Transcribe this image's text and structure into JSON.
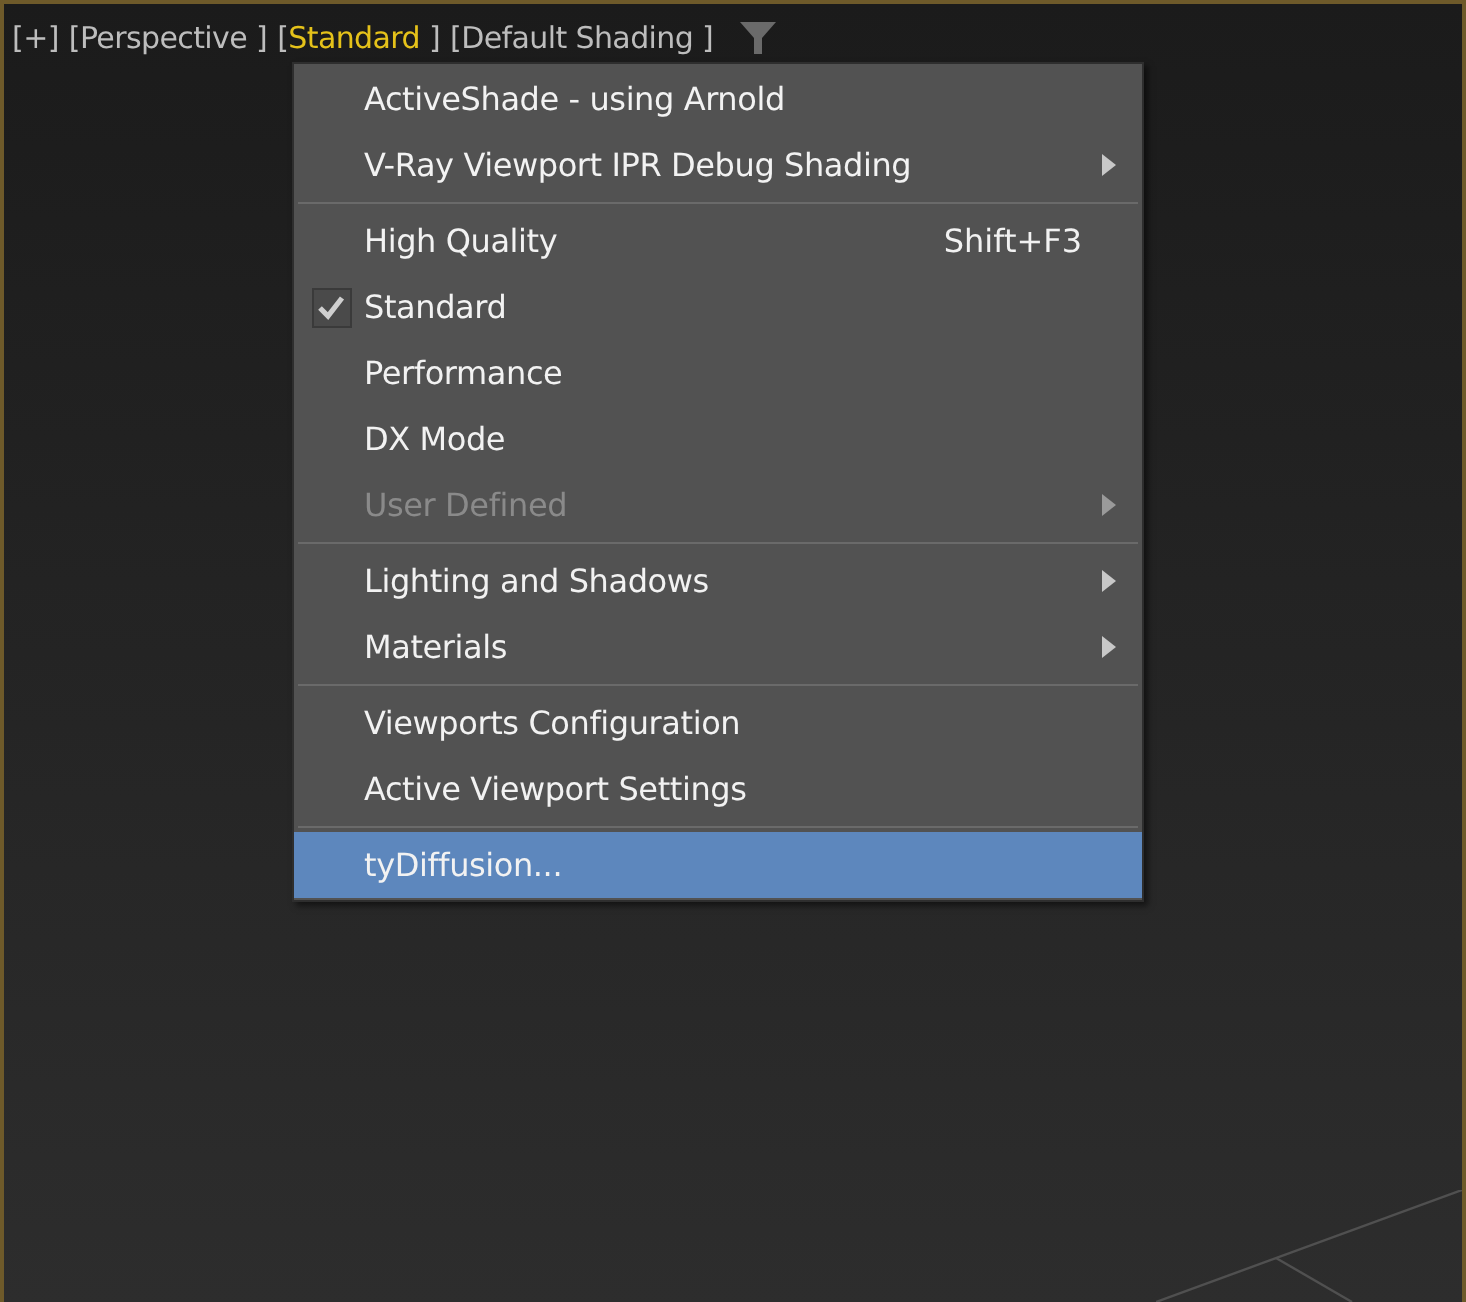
{
  "viewport": {
    "labels": [
      {
        "open": "[",
        "text": "+",
        "close": "]",
        "highlighted": false
      },
      {
        "open": "[",
        "text": "Perspective",
        "close": " ]",
        "highlighted": false
      },
      {
        "open": "[",
        "text": "Standard",
        "close": " ]",
        "highlighted": true
      },
      {
        "open": "[",
        "text": "Default Shading",
        "close": " ]",
        "highlighted": false
      }
    ],
    "menu": {
      "items": [
        {
          "kind": "item",
          "label": "ActiveShade - using Arnold",
          "checked": false,
          "disabled": false,
          "has_submenu": false,
          "selected": false
        },
        {
          "kind": "item",
          "label": "V-Ray Viewport IPR Debug Shading",
          "checked": false,
          "disabled": false,
          "has_submenu": true,
          "selected": false
        },
        {
          "kind": "separator"
        },
        {
          "kind": "item",
          "label": "High Quality",
          "shortcut": "Shift+F3",
          "checked": false,
          "disabled": false,
          "has_submenu": false,
          "selected": false
        },
        {
          "kind": "item",
          "label": "Standard",
          "checked": true,
          "disabled": false,
          "has_submenu": false,
          "selected": false
        },
        {
          "kind": "item",
          "label": "Performance",
          "checked": false,
          "disabled": false,
          "has_submenu": false,
          "selected": false
        },
        {
          "kind": "item",
          "label": "DX Mode",
          "checked": false,
          "disabled": false,
          "has_submenu": false,
          "selected": false
        },
        {
          "kind": "item",
          "label": "User Defined",
          "checked": false,
          "disabled": true,
          "has_submenu": true,
          "selected": false
        },
        {
          "kind": "separator"
        },
        {
          "kind": "item",
          "label": "Lighting and Shadows",
          "checked": false,
          "disabled": false,
          "has_submenu": true,
          "selected": false
        },
        {
          "kind": "item",
          "label": "Materials",
          "checked": false,
          "disabled": false,
          "has_submenu": true,
          "selected": false
        },
        {
          "kind": "separator"
        },
        {
          "kind": "item",
          "label": "Viewports Configuration",
          "checked": false,
          "disabled": false,
          "has_submenu": false,
          "selected": false
        },
        {
          "kind": "item",
          "label": "Active Viewport Settings",
          "checked": false,
          "disabled": false,
          "has_submenu": false,
          "selected": false
        },
        {
          "kind": "separator"
        },
        {
          "kind": "item",
          "label": "tyDiffusion...",
          "checked": false,
          "disabled": false,
          "has_submenu": false,
          "selected": true
        }
      ]
    }
  }
}
